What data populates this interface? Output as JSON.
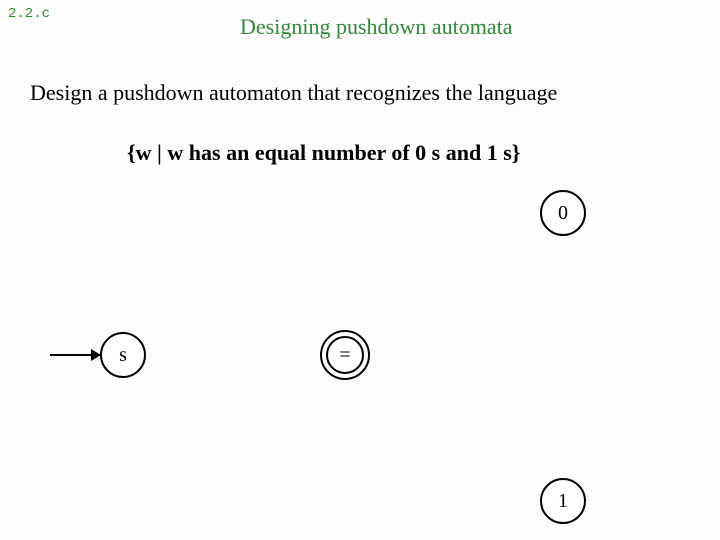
{
  "corner_label": "2.2.c",
  "title": "Designing pushdown automata",
  "description": "Design a pushdown automaton that recognizes the language",
  "language_spec": "{w | w has an equal number of 0 s and 1 s}",
  "states": {
    "s": "s",
    "eq": "=",
    "zero": "0",
    "one": "1"
  }
}
